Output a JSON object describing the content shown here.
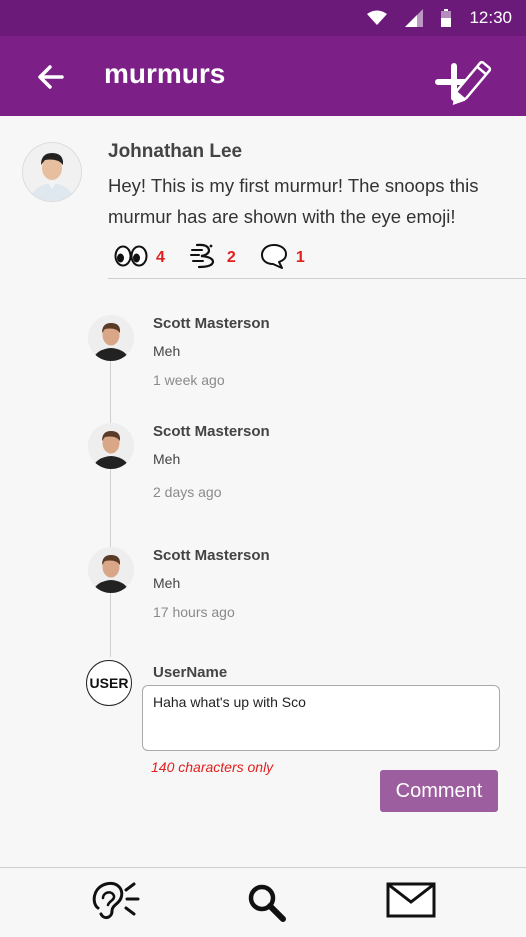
{
  "status_bar": {
    "time": "12:30",
    "icons": [
      "wifi-icon",
      "signal-icon",
      "battery-icon"
    ]
  },
  "app_bar": {
    "title": "murmurs",
    "back_icon": "back-arrow-icon",
    "compose_icon": "compose-icon"
  },
  "post": {
    "author": "Johnathan Lee",
    "text": "Hey! This is my first murmur! The snoops this murmur has are shown with the eye emoji!",
    "actions": [
      {
        "icon": "eyes-icon",
        "count": "4"
      },
      {
        "icon": "whisper-icon",
        "count": "2"
      },
      {
        "icon": "comment-bubble-icon",
        "count": "1"
      }
    ]
  },
  "comments": [
    {
      "author": "Scott Masterson",
      "text": "Meh",
      "time": "1 week ago"
    },
    {
      "author": "Scott Masterson",
      "text": "Meh",
      "time": "2 days ago"
    },
    {
      "author": "Scott Masterson",
      "text": "Meh",
      "time": "17 hours ago"
    }
  ],
  "composer": {
    "avatar_label": "USER",
    "username": "UserName",
    "input_value": "Haha what's up with Sco",
    "limit_note": "140 characters only",
    "submit_label": "Comment"
  },
  "bottom_nav": {
    "items": [
      "listen-ear-icon",
      "search-icon",
      "mail-icon"
    ]
  },
  "colors": {
    "status_bar": "#6b1a7a",
    "app_bar": "#7c1f86",
    "button": "#9c5e9e",
    "count_red": "#e0201e"
  }
}
